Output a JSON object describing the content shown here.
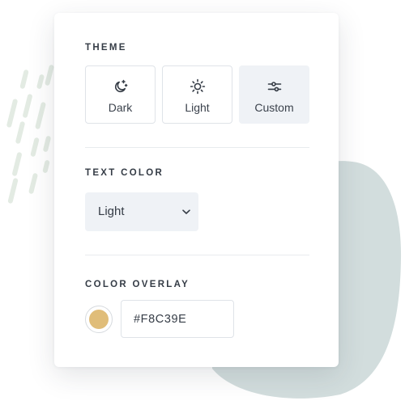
{
  "theme": {
    "heading": "THEME",
    "options": [
      {
        "label": "Dark",
        "icon": "moon-stars-icon"
      },
      {
        "label": "Light",
        "icon": "sun-icon"
      },
      {
        "label": "Custom",
        "icon": "sliders-icon"
      }
    ],
    "selected": "Custom"
  },
  "text_color": {
    "heading": "TEXT COLOR",
    "selected_value": "Light",
    "dropdown_icon": "chevron-down-icon"
  },
  "color_overlay": {
    "heading": "COLOR OVERLAY",
    "hex_value": "#F8C39E",
    "swatch_color": "#E0BD79"
  },
  "colors": {
    "accent_blob": "#D2DDDD",
    "dashes": "#E3EBE3",
    "active_tab_bg": "#EFF2F6"
  }
}
